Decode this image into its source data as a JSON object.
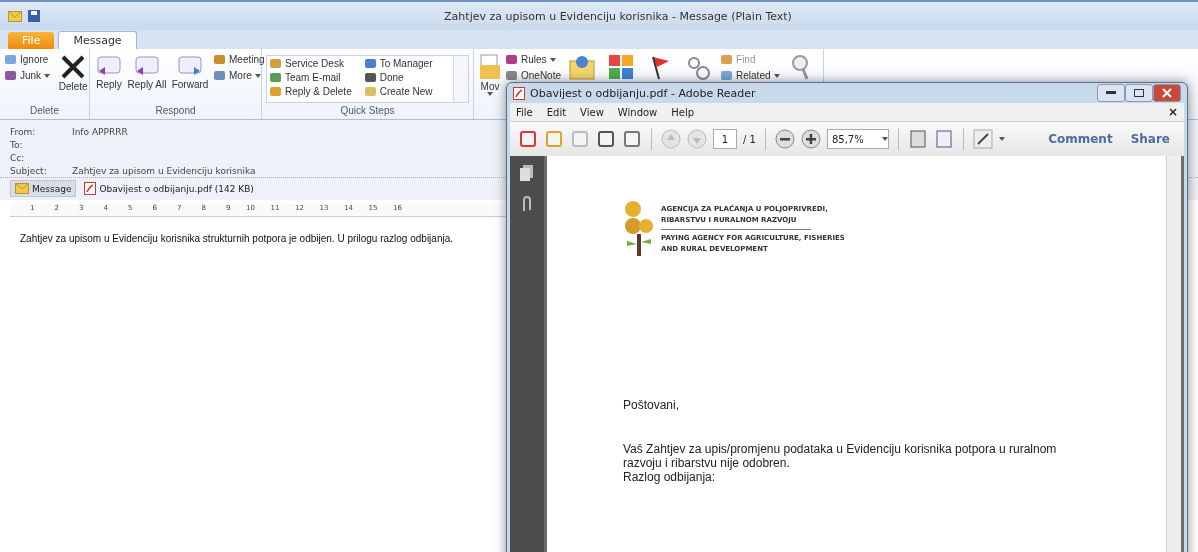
{
  "outlook": {
    "title": "Zahtjev za upisom u Evidenciju korisnika  -  Message (Plain Text)",
    "tabs": [
      {
        "label": "File",
        "selected": false,
        "kind": "file"
      },
      {
        "label": "Message",
        "selected": true,
        "kind": "tab"
      }
    ],
    "ribbon": [
      {
        "label": "Delete",
        "columns": [
          [
            {
              "kind": "small",
              "label": "Ignore"
            },
            {
              "kind": "small",
              "label": "Junk",
              "menu": true
            }
          ],
          [
            {
              "kind": "large",
              "label": "Delete"
            }
          ]
        ]
      },
      {
        "label": "Respond",
        "columns": [
          [
            {
              "kind": "large",
              "label": "Reply"
            }
          ],
          [
            {
              "kind": "large",
              "label": "Reply All"
            }
          ],
          [
            {
              "kind": "large",
              "label": "Forward"
            }
          ],
          [
            {
              "kind": "small",
              "label": "Meeting"
            },
            {
              "kind": "small",
              "label": "More",
              "menu": true
            }
          ]
        ]
      },
      {
        "label": "Quick Steps",
        "kind": "gallery",
        "columns": [
          [
            {
              "kind": "small",
              "label": "Service Desk"
            },
            {
              "kind": "small",
              "label": "Team E-mail"
            },
            {
              "kind": "small",
              "label": "Reply & Delete"
            }
          ],
          [
            {
              "kind": "small",
              "label": "To Manager"
            },
            {
              "kind": "small",
              "label": "Done"
            },
            {
              "kind": "small",
              "label": "Create New"
            }
          ]
        ]
      },
      {
        "columns": [
          [
            {
              "kind": "large",
              "label": "Mov",
              "menu": true
            }
          ],
          [
            {
              "kind": "small",
              "label": "Rules",
              "menu": true
            },
            {
              "kind": "small",
              "label": "OneNote"
            }
          ],
          [
            {
              "kind": "large"
            }
          ],
          [
            {
              "kind": "large"
            }
          ],
          [
            {
              "kind": "large"
            }
          ],
          [
            {
              "kind": "large"
            }
          ],
          [
            {
              "kind": "small",
              "label": "Find",
              "disabled": true
            },
            {
              "kind": "small",
              "label": "Related",
              "menu": true
            }
          ],
          [
            {
              "kind": "large"
            }
          ]
        ]
      }
    ],
    "header": [
      {
        "label": "From:",
        "value": "Info APPRRR"
      },
      {
        "label": "To:"
      },
      {
        "label": "Cc:"
      },
      {
        "label": "Subject:",
        "value": "Zahtjev za upisom u Evidenciju korisnika"
      }
    ],
    "attachments": [
      {
        "label": "Message",
        "selected": true,
        "kind": "message"
      },
      {
        "label": "Obavijest o odbijanju.pdf (142 KB)",
        "selected": false,
        "kind": "pdf"
      }
    ],
    "ruler": [
      "1",
      "2",
      "3",
      "4",
      "5",
      "6",
      "7",
      "8",
      "9",
      "10",
      "11",
      "12",
      "13",
      "14",
      "15",
      "16"
    ],
    "body": "Zahtjev za upisom u Evidenciju korisnika strukturnih potpora je odbijen. U prilogu razlog odbijanja."
  },
  "reader": {
    "title": "Obavijest o odbijanju.pdf - Adobe Reader",
    "menu": [
      "File",
      "Edit",
      "View",
      "Window",
      "Help"
    ],
    "close_doc": "×",
    "page": "1",
    "page_total": "/ 1",
    "zoom": "85,7%",
    "actions": [
      "Comment",
      "Share"
    ],
    "document": {
      "logo_lines": [
        "AGENCIJA ZA PLAĆANJA U POLJOPRIVREDI,",
        "RIBARSTVU I RURALNOM RAZVOJU"
      ],
      "logo_lines_en": [
        "PAYING AGENCY FOR AGRICULTURE, FISHERIES",
        "AND RURAL DEVELOPMENT"
      ],
      "greeting": "Poštovani,",
      "lines": [
        "Vaš Zahtjev za upis/promjenu podataka u Evidenciju korisnika potpora u ruralnom",
        "razvoju i ribarstvu nije odobren.",
        "Razlog odbijanja:"
      ]
    }
  }
}
